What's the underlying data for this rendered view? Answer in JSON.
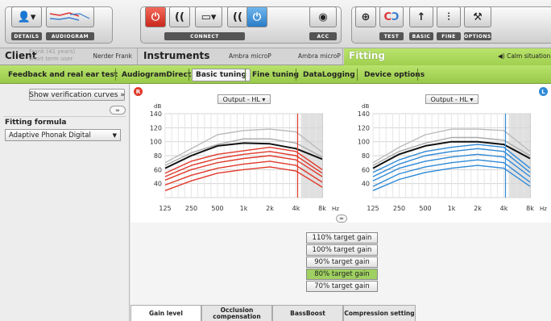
{
  "toolbar": {
    "details_label": "DETAILS",
    "audiogram_label": "AUDIOGRAM",
    "connect_label": "CONNECT",
    "acc_label": "ACC",
    "test_label": "TEST",
    "basic_label": "BASIC",
    "fine_label": "FINE",
    "options_label": "OPTIONS"
  },
  "header": {
    "client_title": "Client",
    "client_name_overlay": "Frank (41 years)",
    "client_sub_overlay": "short term user",
    "client_name": "Nerder Frank",
    "instruments_title": "Instruments",
    "instrument_left": "Ambra microP",
    "instrument_right": "Ambra microP",
    "fitting_title": "Fitting",
    "calm_situation": "Calm situation"
  },
  "nav": {
    "tabs": [
      {
        "label": "Feedback and real ear test"
      },
      {
        "label": "AudiogramDirect"
      },
      {
        "label": "Basic tuning"
      },
      {
        "label": "Fine tuning"
      },
      {
        "label": "DataLogging"
      },
      {
        "label": "Device options"
      }
    ],
    "active": "Basic tuning"
  },
  "left": {
    "verify_button": "Show verification curves »",
    "formula_heading": "Fitting formula",
    "formula_value": "Adaptive Phonak Digital"
  },
  "charts": {
    "left_badge": "R",
    "right_badge": "L",
    "left_dropdown": "Output - HL ▾",
    "right_dropdown": "Output - HL ▾",
    "y_unit": "dB",
    "x_unit": "Hz"
  },
  "chart_data": [
    {
      "type": "line",
      "side": "right ear",
      "accent_color": "#e23a2c",
      "x": [
        125,
        250,
        500,
        1000,
        2000,
        4000,
        8000
      ],
      "x_ticks": [
        "125",
        "250",
        "500",
        "1k",
        "2k",
        "4k",
        "8k"
      ],
      "y_ticks": [
        20,
        40,
        60,
        80,
        100,
        120,
        140
      ],
      "ylabel": "dB",
      "xlabel": "Hz",
      "ylim": [
        20,
        140
      ],
      "series": [
        {
          "values": [
            62,
            80,
            94,
            98,
            97,
            90,
            75
          ],
          "color": "#111"
        },
        {
          "values": [
            70,
            90,
            110,
            116,
            118,
            114,
            85
          ],
          "color": "#bbb"
        },
        {
          "values": [
            66,
            84,
            96,
            104,
            104,
            98,
            78
          ],
          "color": "#aaa"
        },
        {
          "values": [
            55,
            72,
            82,
            87,
            92,
            86,
            60
          ],
          "color": "#e23a2c"
        },
        {
          "values": [
            50,
            66,
            76,
            82,
            86,
            80,
            55
          ],
          "color": "#e23a2c"
        },
        {
          "values": [
            45,
            60,
            70,
            76,
            80,
            74,
            50
          ],
          "color": "#e23a2c"
        },
        {
          "values": [
            38,
            52,
            62,
            68,
            72,
            66,
            42
          ],
          "color": "#e23a2c"
        },
        {
          "values": [
            30,
            44,
            55,
            60,
            64,
            58,
            35
          ],
          "color": "#e23a2c"
        }
      ]
    },
    {
      "type": "line",
      "side": "left ear",
      "accent_color": "#2f8ad8",
      "x": [
        125,
        250,
        500,
        1000,
        2000,
        4000,
        8000
      ],
      "x_ticks": [
        "125",
        "250",
        "500",
        "1k",
        "2k",
        "4k",
        "8k"
      ],
      "y_ticks": [
        20,
        40,
        60,
        80,
        100,
        120,
        140
      ],
      "ylabel": "dB",
      "xlabel": "Hz",
      "ylim": [
        20,
        140
      ],
      "series": [
        {
          "values": [
            62,
            82,
            94,
            100,
            100,
            96,
            76
          ],
          "color": "#111"
        },
        {
          "values": [
            70,
            92,
            110,
            118,
            118,
            116,
            86
          ],
          "color": "#bbb"
        },
        {
          "values": [
            66,
            86,
            98,
            106,
            106,
            102,
            80
          ],
          "color": "#aaa"
        },
        {
          "values": [
            56,
            74,
            86,
            92,
            96,
            92,
            62
          ],
          "color": "#2f8ad8"
        },
        {
          "values": [
            50,
            68,
            80,
            86,
            90,
            86,
            56
          ],
          "color": "#2f8ad8"
        },
        {
          "values": [
            44,
            62,
            72,
            78,
            82,
            78,
            50
          ],
          "color": "#2f8ad8"
        },
        {
          "values": [
            36,
            54,
            64,
            70,
            74,
            70,
            42
          ],
          "color": "#2f8ad8"
        },
        {
          "values": [
            30,
            46,
            56,
            62,
            66,
            62,
            36
          ],
          "color": "#2f8ad8"
        }
      ]
    }
  ],
  "target_gain": {
    "options": [
      "110% target gain",
      "100% target gain",
      "90% target gain",
      "80% target gain",
      "70% target gain"
    ],
    "selected": "80% target gain"
  },
  "bottom_tabs": [
    {
      "label": "Gain level"
    },
    {
      "label": "Occlusion compensation"
    },
    {
      "label": "BassBoost"
    },
    {
      "label": "Compression setting"
    }
  ],
  "colors": {
    "green_accent": "#a6d55a",
    "right_ear": "#e23a2c",
    "left_ear": "#2f8ad8"
  }
}
